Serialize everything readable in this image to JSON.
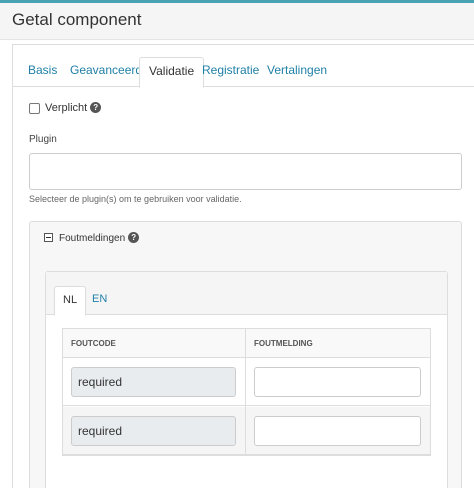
{
  "window": {
    "title": "Getal component"
  },
  "tabs": [
    {
      "label": "Basis"
    },
    {
      "label": "Geavanceerd"
    },
    {
      "label": "Validatie",
      "active": true
    },
    {
      "label": "Registratie"
    },
    {
      "label": "Vertalingen"
    }
  ],
  "required_checkbox": {
    "label": "Verplicht",
    "checked": false,
    "help_icon": "question-circle-icon"
  },
  "plugin": {
    "label": "Plugin",
    "value": "",
    "hint": "Selecteer de plugin(s) om te gebruiken voor validatie."
  },
  "error_panel": {
    "title": "Foutmeldingen",
    "collapse_icon": "minus-square-icon",
    "help_icon": "question-circle-icon",
    "languages": [
      {
        "label": "NL",
        "active": true
      },
      {
        "label": "EN"
      }
    ],
    "columns": [
      "FOUTCODE",
      "FOUTMELDING"
    ],
    "rows": [
      {
        "code": "required",
        "message": ""
      },
      {
        "code": "required",
        "message": ""
      }
    ]
  },
  "colors": {
    "link": "#1f7fa6",
    "accent_bar": "#4aa3b5"
  }
}
